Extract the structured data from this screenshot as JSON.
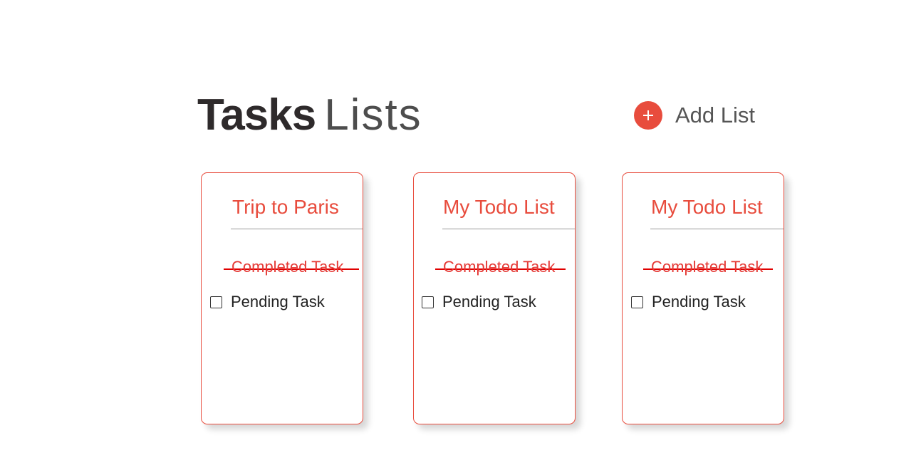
{
  "header": {
    "title_bold": "Tasks",
    "title_light": "Lists",
    "add_list_label": "Add List",
    "add_icon": "plus-icon"
  },
  "lists": [
    {
      "title": "Trip to Paris",
      "completed_task": "Completed Task",
      "pending_task": "Pending Task"
    },
    {
      "title": "My Todo List",
      "completed_task": "Completed Task",
      "pending_task": "Pending Task"
    },
    {
      "title": "My Todo List",
      "completed_task": "Completed Task",
      "pending_task": "Pending Task"
    }
  ],
  "colors": {
    "accent": "#e84c3d",
    "title_dark": "#2e2a2b",
    "strike": "#e00000"
  }
}
